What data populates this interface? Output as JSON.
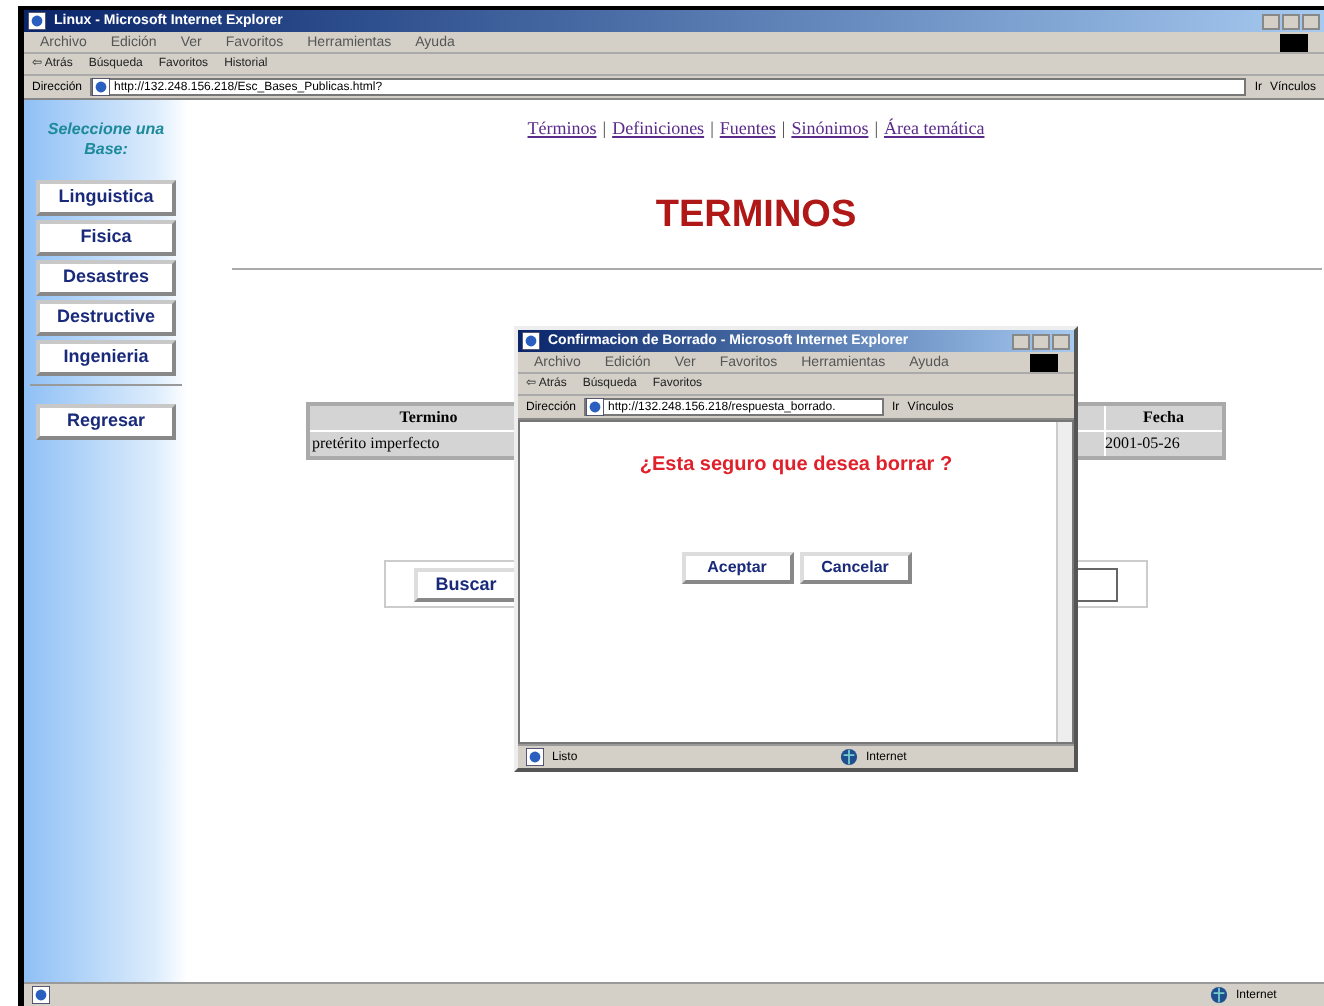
{
  "window": {
    "title": "Linux - Microsoft Internet Explorer",
    "menu": [
      "Archivo",
      "Edición",
      "Ver",
      "Favoritos",
      "Herramientas",
      "Ayuda"
    ],
    "toolbar": [
      "⇦ Atrás",
      "Búsqueda",
      "Favoritos",
      "Historial"
    ],
    "address_label": "Dirección",
    "address": "http://132.248.156.218/Esc_Bases_Publicas.html?",
    "go": "Ir",
    "links": "Vínculos"
  },
  "sidebar": {
    "prompt": "Seleccione una Base:",
    "items": [
      "Linguistica",
      "Fisica",
      "Desastres",
      "Destructive",
      "Ingenieria"
    ],
    "back": "Regresar"
  },
  "nav_separator": "|",
  "nav_links": [
    "Términos",
    "Definiciones",
    "Fuentes",
    "Sinónimos",
    "Área temática"
  ],
  "heading": "TERMINOS",
  "table": {
    "columns": [
      "Termino",
      "Fecha"
    ],
    "rows": [
      [
        "pretérito imperfecto",
        "2001-05-26"
      ]
    ]
  },
  "search_button": "Buscar",
  "dialog": {
    "title": "Confirmacion de Borrado - Microsoft Internet Explorer",
    "menu": [
      "Archivo",
      "Edición",
      "Ver",
      "Favoritos",
      "Herramientas",
      "Ayuda"
    ],
    "toolbar": [
      "⇦ Atrás",
      "Búsqueda",
      "Favoritos"
    ],
    "address_label": "Dirección",
    "address": "http://132.248.156.218/respuesta_borrado.",
    "go": "Ir",
    "links": "Vínculos",
    "question": "¿Esta seguro que desea borrar ?",
    "buttons": [
      "Aceptar",
      "Cancelar"
    ],
    "status": "Listo",
    "zone": "Internet"
  },
  "status_bar": {
    "zone": "Internet"
  }
}
